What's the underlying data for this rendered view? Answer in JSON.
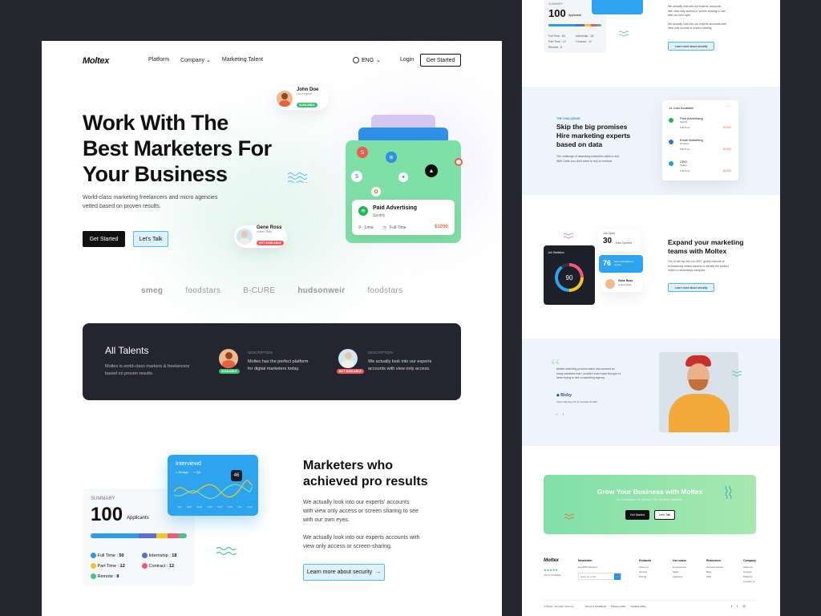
{
  "brand": {
    "name": "Moltex"
  },
  "nav": {
    "items": [
      "Platform",
      "Company",
      "Marketing Talent"
    ],
    "lang": "ENG",
    "login": "Login",
    "cta": "Get Started"
  },
  "hero": {
    "title_lines": [
      "Work With The",
      "Best Marketers For",
      "Your Business"
    ],
    "subtitle_lines": [
      "World-class marketing freelancers and micro agencies",
      "vetted based on proven results."
    ],
    "primary_cta": "Get Started",
    "secondary_cta": "Let's Talk",
    "profile1": {
      "name": "John Doe",
      "location": "Los Angeles",
      "status": "AVAILABLE"
    },
    "profile2": {
      "name": "Gene Ross",
      "location": "United State",
      "status": "NOT AVAILABLE"
    },
    "job": {
      "title": "Paid Advertising",
      "company": "Spotify",
      "location": "Lima",
      "type": "Full-Time",
      "price": "$1200"
    }
  },
  "logos": [
    "smeg",
    "foodstars",
    "B-CURE",
    "hudsonweir",
    "foodstars"
  ],
  "talents": {
    "title": "All Talents",
    "desc_lines": [
      "Moltex is eorld-class markers & freelancers",
      "based on proven results."
    ],
    "items": [
      {
        "label": "DESCRIPTION",
        "text_lines": [
          "Moltex has the perfect platform",
          "for digital marketers today."
        ],
        "status": "AVAILABLE"
      },
      {
        "label": "DESCRIPTION",
        "text_lines": [
          "We actually look into our experts",
          "accounts with view only access."
        ],
        "status": "NOT AVAILABLE"
      }
    ]
  },
  "results": {
    "chart_title": "Interviewd",
    "legend": [
      "Design",
      "QA"
    ],
    "marker": "46",
    "months": [
      "JAN",
      "FEB",
      "MAR",
      "APR",
      "MAY",
      "JUN",
      "JUL",
      "AUG"
    ],
    "summary_label": "SUMMARY",
    "summary_value": "100",
    "summary_unit": "Applicants",
    "stats": [
      {
        "label": "Full Time",
        "value": "50",
        "color": "#2f9ae6"
      },
      {
        "label": "Internship",
        "value": "18",
        "color": "#5b6ed6"
      },
      {
        "label": "Part Time",
        "value": "12",
        "color": "#f3c623"
      },
      {
        "label": "Contract",
        "value": "12",
        "color": "#ef5a7a"
      },
      {
        "label": "Remote",
        "value": "8",
        "color": "#4cc486"
      }
    ],
    "heading_lines": [
      "Marketers who",
      "achieved pro results"
    ],
    "para1_lines": [
      "We actually look into our experts' accounts",
      "with view only access or screen sharing to see",
      "with our own eyes."
    ],
    "para2_lines": [
      "We actually look into our experts accounts with",
      "view only access or screen-sharing."
    ],
    "cta": "Learn more about security"
  },
  "right": {
    "top": {
      "summary_label": "SUMMARY",
      "value": "100",
      "unit": "Applicants",
      "stats": [
        "Full Time : 50",
        "Internship : 18",
        "Part Time : 12",
        "Contract : 12",
        "Remote : 8"
      ],
      "text_lines": [
        "We actually look into our experts' accounts",
        "with view only access or screen sharing to see",
        "with our own eyes."
      ],
      "text2_lines": [
        "We actually look into our experts accounts with",
        "view only access or screen-sharing."
      ],
      "cta": "Learn more about security"
    },
    "challenge": {
      "label": "THE CHALLENGE",
      "heading_lines": [
        "Skip the big promises",
        "Hire marketing experts",
        "based on data"
      ],
      "text_lines": [
        "The challenge of assessing marketers skills is real.",
        "With Cobie you don't need to rely on reviews."
      ],
      "jobs_title": "14 Jobs Available",
      "jobs": [
        {
          "title": "Paid Advertising",
          "company": "Spotify",
          "type": "Full-Time",
          "price": "$1200",
          "color": "#1db954"
        },
        {
          "title": "Email Marketing",
          "company": "Dropbox",
          "type": "Full-Time",
          "price": "$1000",
          "color": "#2f74e6"
        },
        {
          "title": "CRO",
          "company": "Twitter",
          "type": "Full-Time",
          "price": "$1000",
          "color": "#1da1f2"
        }
      ]
    },
    "expand": {
      "heading_lines": [
        "Expand your marketing",
        "teams with Moltex"
      ],
      "text_lines": [
        "Our AI will tap into our 600+ global network of",
        "exhaustively vetted experts to identify the perfect",
        "match to seamlessly integrate."
      ],
      "cta": "Learn more about security",
      "stats_title": "Job Statistics",
      "gauge": "90",
      "job_open_label": "Job Open",
      "job_open_value": "30",
      "job_open_unit": "Jobs Opened",
      "candidates_value": "76",
      "candidates_text": "New candidates to review",
      "person": "Gene Ross",
      "person_loc": "United State"
    },
    "testimonial": {
      "quote_lines": [
        "Moltex matching process takes into account so",
        "many variables that I wouldn't even have thought of",
        "when trying to hire a marketing agency."
      ],
      "company": "Bixby",
      "author": "Victor Hanning, Ph.D. Founder & CEO"
    },
    "grow": {
      "title": "Grow Your Business with Moltex",
      "sub": "No commission, no contract. Hire the best marketers.",
      "primary": "Get Started",
      "secondary": "Let's Talk"
    },
    "footer": {
      "brand": "Moltex",
      "rating": "4.8 on Trustpilot",
      "newsletter": "Newsletter",
      "newsletter_sub": "Get 15% discount",
      "email_placeholder": "Enter an email",
      "cols": [
        {
          "title": "Products",
          "items": [
            "About us",
            "Service",
            "Pricing"
          ]
        },
        {
          "title": "Use cases",
          "items": [
            "E-commerce",
            "SaaS",
            "Agencies"
          ]
        },
        {
          "title": "Resources",
          "items": [
            "Success stories",
            "Blog",
            "FAQ"
          ]
        },
        {
          "title": "Company",
          "items": [
            "About us",
            "Careers",
            "Partners",
            "Contact us"
          ]
        }
      ],
      "copyright": "© Moltex. All rights reserved",
      "links": [
        "Terms & Conditions",
        "Privacy policy",
        "Cookies policy"
      ]
    }
  }
}
